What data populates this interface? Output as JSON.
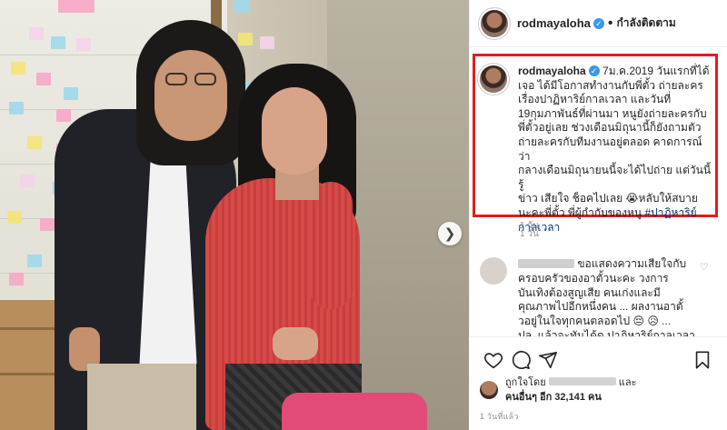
{
  "post": {
    "username": "rodmayaloha",
    "follow_status": "กำลังติดตาม",
    "caption_lines": [
      "7ม.ค.2019 วันแรกที่ได้",
      "เจอ ได้มีโอกาสทำงานกับพี่ตั้ว ถ่ายละคร",
      "เรื่องปาฏิหาริย์กาลเวลา และวันที่",
      "19กุมภาพันธ์ที่ผ่านมา หนูยังถ่ายละครกับ",
      "พี่ตั้วอยู่เลย ช่วงเดือนมิถุนานี้ก็ยังถามตัว",
      "ถ่ายละครกับทีมงานอยู่ตลอด คาดการณ์ว่า",
      "กลางเดือนมิถุนายนนี้จะได้ไปถ่าย แต่วันนี้รู้",
      "ข่าว เสียใจ ช็อคไปเลย 😭หลับให้สบาย",
      "นะคะพี่ตั้ว พี่ผู้กำกับของหนู"
    ],
    "hashtag_lines": [
      "#ปาฏิหาริย์",
      "กาลเวลา"
    ],
    "caption_age": "1 วัน",
    "reply_age": "1 วัน"
  },
  "comment": {
    "lines": [
      "ขอแสดงความเสียใจกับ",
      "ครอบครัวของอาตั้วนะคะ วงการ",
      "บันเทิงต้องสูญเสีย คนเก่งและมี",
      "คุณภาพไปอีกหนึ่งคน ... ผลงานอาตั้",
      "วอยู่ในใจทุกคนตลอดไป 😔 😥 ...",
      "ปล. แล้วจะทันได้ดู ปาฏิหาริย์กาลเวลา"
    ]
  },
  "likes": {
    "prefix": "ถูกใจโดย",
    "suffix": "และ",
    "others_label": "คนอื่นๆ อีก 32,141 คน"
  },
  "posted_label": "1 วันที่แล้ว",
  "icons": {
    "verified": "verified-badge",
    "like": "heart-icon",
    "comment": "comment-icon",
    "share": "share-icon",
    "save": "bookmark-icon",
    "next": "chevron-right-icon"
  },
  "colors": {
    "highlight_box": "#e01e1e",
    "verified": "#3897f0",
    "hashtag": "#00376b"
  }
}
